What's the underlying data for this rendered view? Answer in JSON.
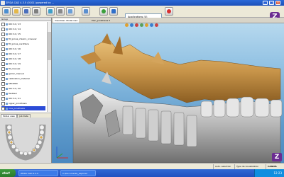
{
  "window": {
    "title": "ZFIDA CAD 4.3.5 (0101) powered by ..."
  },
  "toolbar": {
    "application_label": "Applications (4)"
  },
  "left_panel": {
    "header": "Group",
    "items": [
      {
        "label": "ON 3.2 / 13",
        "selected": false
      },
      {
        "label": "ON 3.2 / 14",
        "selected": false
      },
      {
        "label": "ON 3.2 / 15",
        "selected": false
      },
      {
        "label": "fill_pinna_chiarro_crosover",
        "selected": false
      },
      {
        "label": "fill_pinna_carottera",
        "selected": false
      },
      {
        "label": "ON 3.2 / 16",
        "selected": false
      },
      {
        "label": "ON 3.2 / 17",
        "selected": false
      },
      {
        "label": "ON 3.2 / 18",
        "selected": false
      },
      {
        "label": "ON 3.2 / 19",
        "selected": false
      },
      {
        "label": "fill_manual",
        "selected": false
      },
      {
        "label": "gemic_manual",
        "selected": false
      },
      {
        "label": "calibration_material",
        "selected": false
      },
      {
        "label": "SECOND",
        "selected": false
      },
      {
        "label": "ON 3.2 / 20",
        "selected": false
      },
      {
        "label": "Testbed",
        "selected": false
      },
      {
        "label": "ON 3.2 / 21",
        "selected": false
      },
      {
        "label": "upper_prosthesis",
        "selected": false
      },
      {
        "label": "mss_prosthesis",
        "selected": true
      }
    ],
    "tabs": [
      "Model view",
      "Job Data"
    ]
  },
  "viewport": {
    "tabs": [
      "Visualizer: Model Cad",
      "Plan_prosthesis 0"
    ]
  },
  "status": {
    "segments": [
      "Auto. selection",
      "Type de visualization",
      "CANCEL"
    ]
  },
  "taskbar": {
    "start_label": "start",
    "tasks": [
      "ZFIDA CAD 4.3.5",
      "C:\\Documents_explorer"
    ],
    "clock": "12:23"
  },
  "colors": {
    "title_blue": "#1c4fb8",
    "brand_purple": "#6b2c91",
    "selection_blue": "#2b4bd7",
    "gum_gold": "#c8954a"
  },
  "icons": [
    "home-icon",
    "open-icon",
    "save-icon",
    "print-icon",
    "scan-icon",
    "settings-icon",
    "view-icon",
    "export-icon",
    "refresh-icon",
    "help-icon",
    "stop-icon"
  ]
}
